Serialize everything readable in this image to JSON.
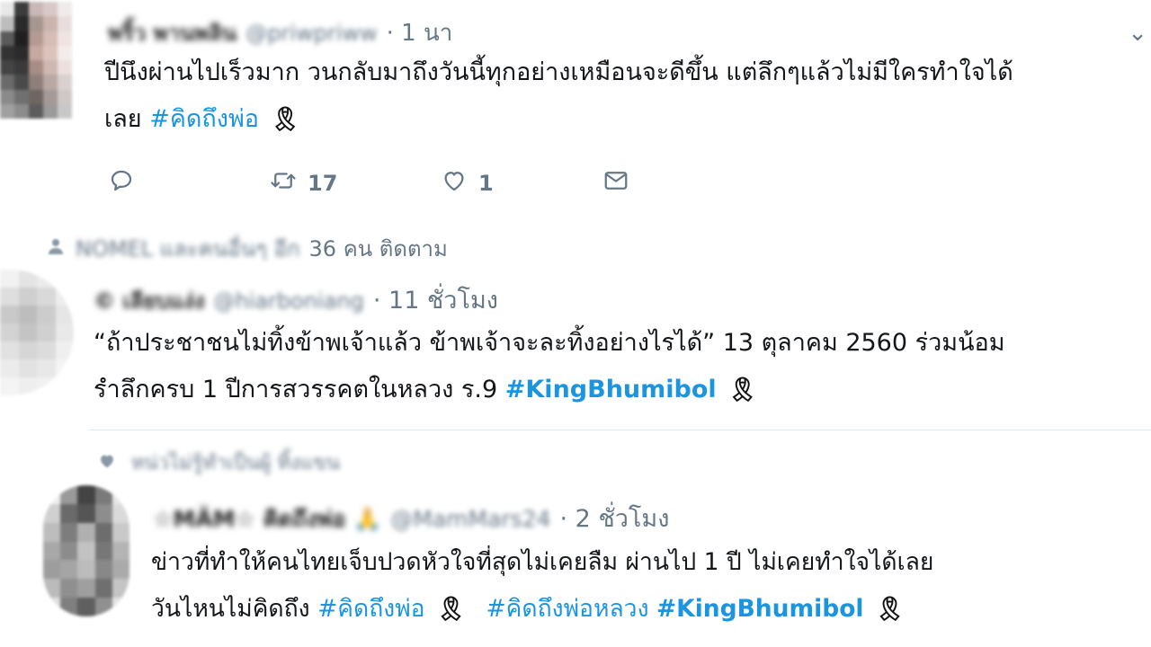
{
  "tweets": [
    {
      "display_name": "พริ้ว พานพลิน",
      "handle": "@priwpriww",
      "time": "· 1 นา",
      "text_line1": "ปีนึงผ่านไปเร็วมาก วนกลับมาถึงวันนี้ทุกอย่างเหมือนจะดีขึ้น แต่ลึกๆแล้วไม่มีใครทำใจได้",
      "text_line2": "เลย",
      "hashtag1": "#คิดถึงพ่อ",
      "ribbon": "🎗",
      "reply_count": "",
      "retweet_count": "17",
      "like_count": "1"
    },
    {
      "social_context_names": "NOMEL และคนอื่นๆ อีก",
      "social_context_suffix": "36 คน ติดตาม",
      "display_name": "© เลียบแง่ง",
      "handle": "@hiarboniang",
      "time": "· 11 ชั่วโมง",
      "text_line1": "“ถ้าประชาชนไม่ทิ้งข้าพเจ้าแล้ว ข้าพเจ้าจะละทิ้งอย่างไรได้” 13 ตุลาคม 2560 ร่วมน้อม",
      "text_line2": "รำลึกครบ 1 ปีการสวรรคตในหลวง ร.9",
      "hashtag1": "#KingBhumibol",
      "ribbon": "🎗"
    },
    {
      "thread_context": "หน่วไม่รู้ทำเป็นผู้ ทิ้งแขน",
      "display_name": "☆MÄM☆ คิดถึงพ่อ 🙏",
      "handle": "@MamMars24",
      "time": "· 2 ชั่วโมง",
      "text_line1": "ข่าวที่ทำให้คนไทยเจ็บปวดหัวใจที่สุดไม่เคยลืม ผ่านไป 1 ปี ไม่เคยทำใจได้เลย",
      "text_line2": "วันไหนไม่คิดถึง",
      "hashtag1": "#คิดถึงพ่อ",
      "hashtag2": "#คิดถึงพ่อหลวง",
      "hashtag3": "#KingBhumibol",
      "ribbon": "🎗"
    }
  ],
  "colors": {
    "link": "#1b95e0",
    "muted": "#657786",
    "text": "#14171a"
  },
  "icons": [
    "reply-icon",
    "retweet-icon",
    "like-icon",
    "message-icon",
    "person-icon",
    "heart-icon",
    "chevron-down-icon",
    "ribbon-icon"
  ]
}
